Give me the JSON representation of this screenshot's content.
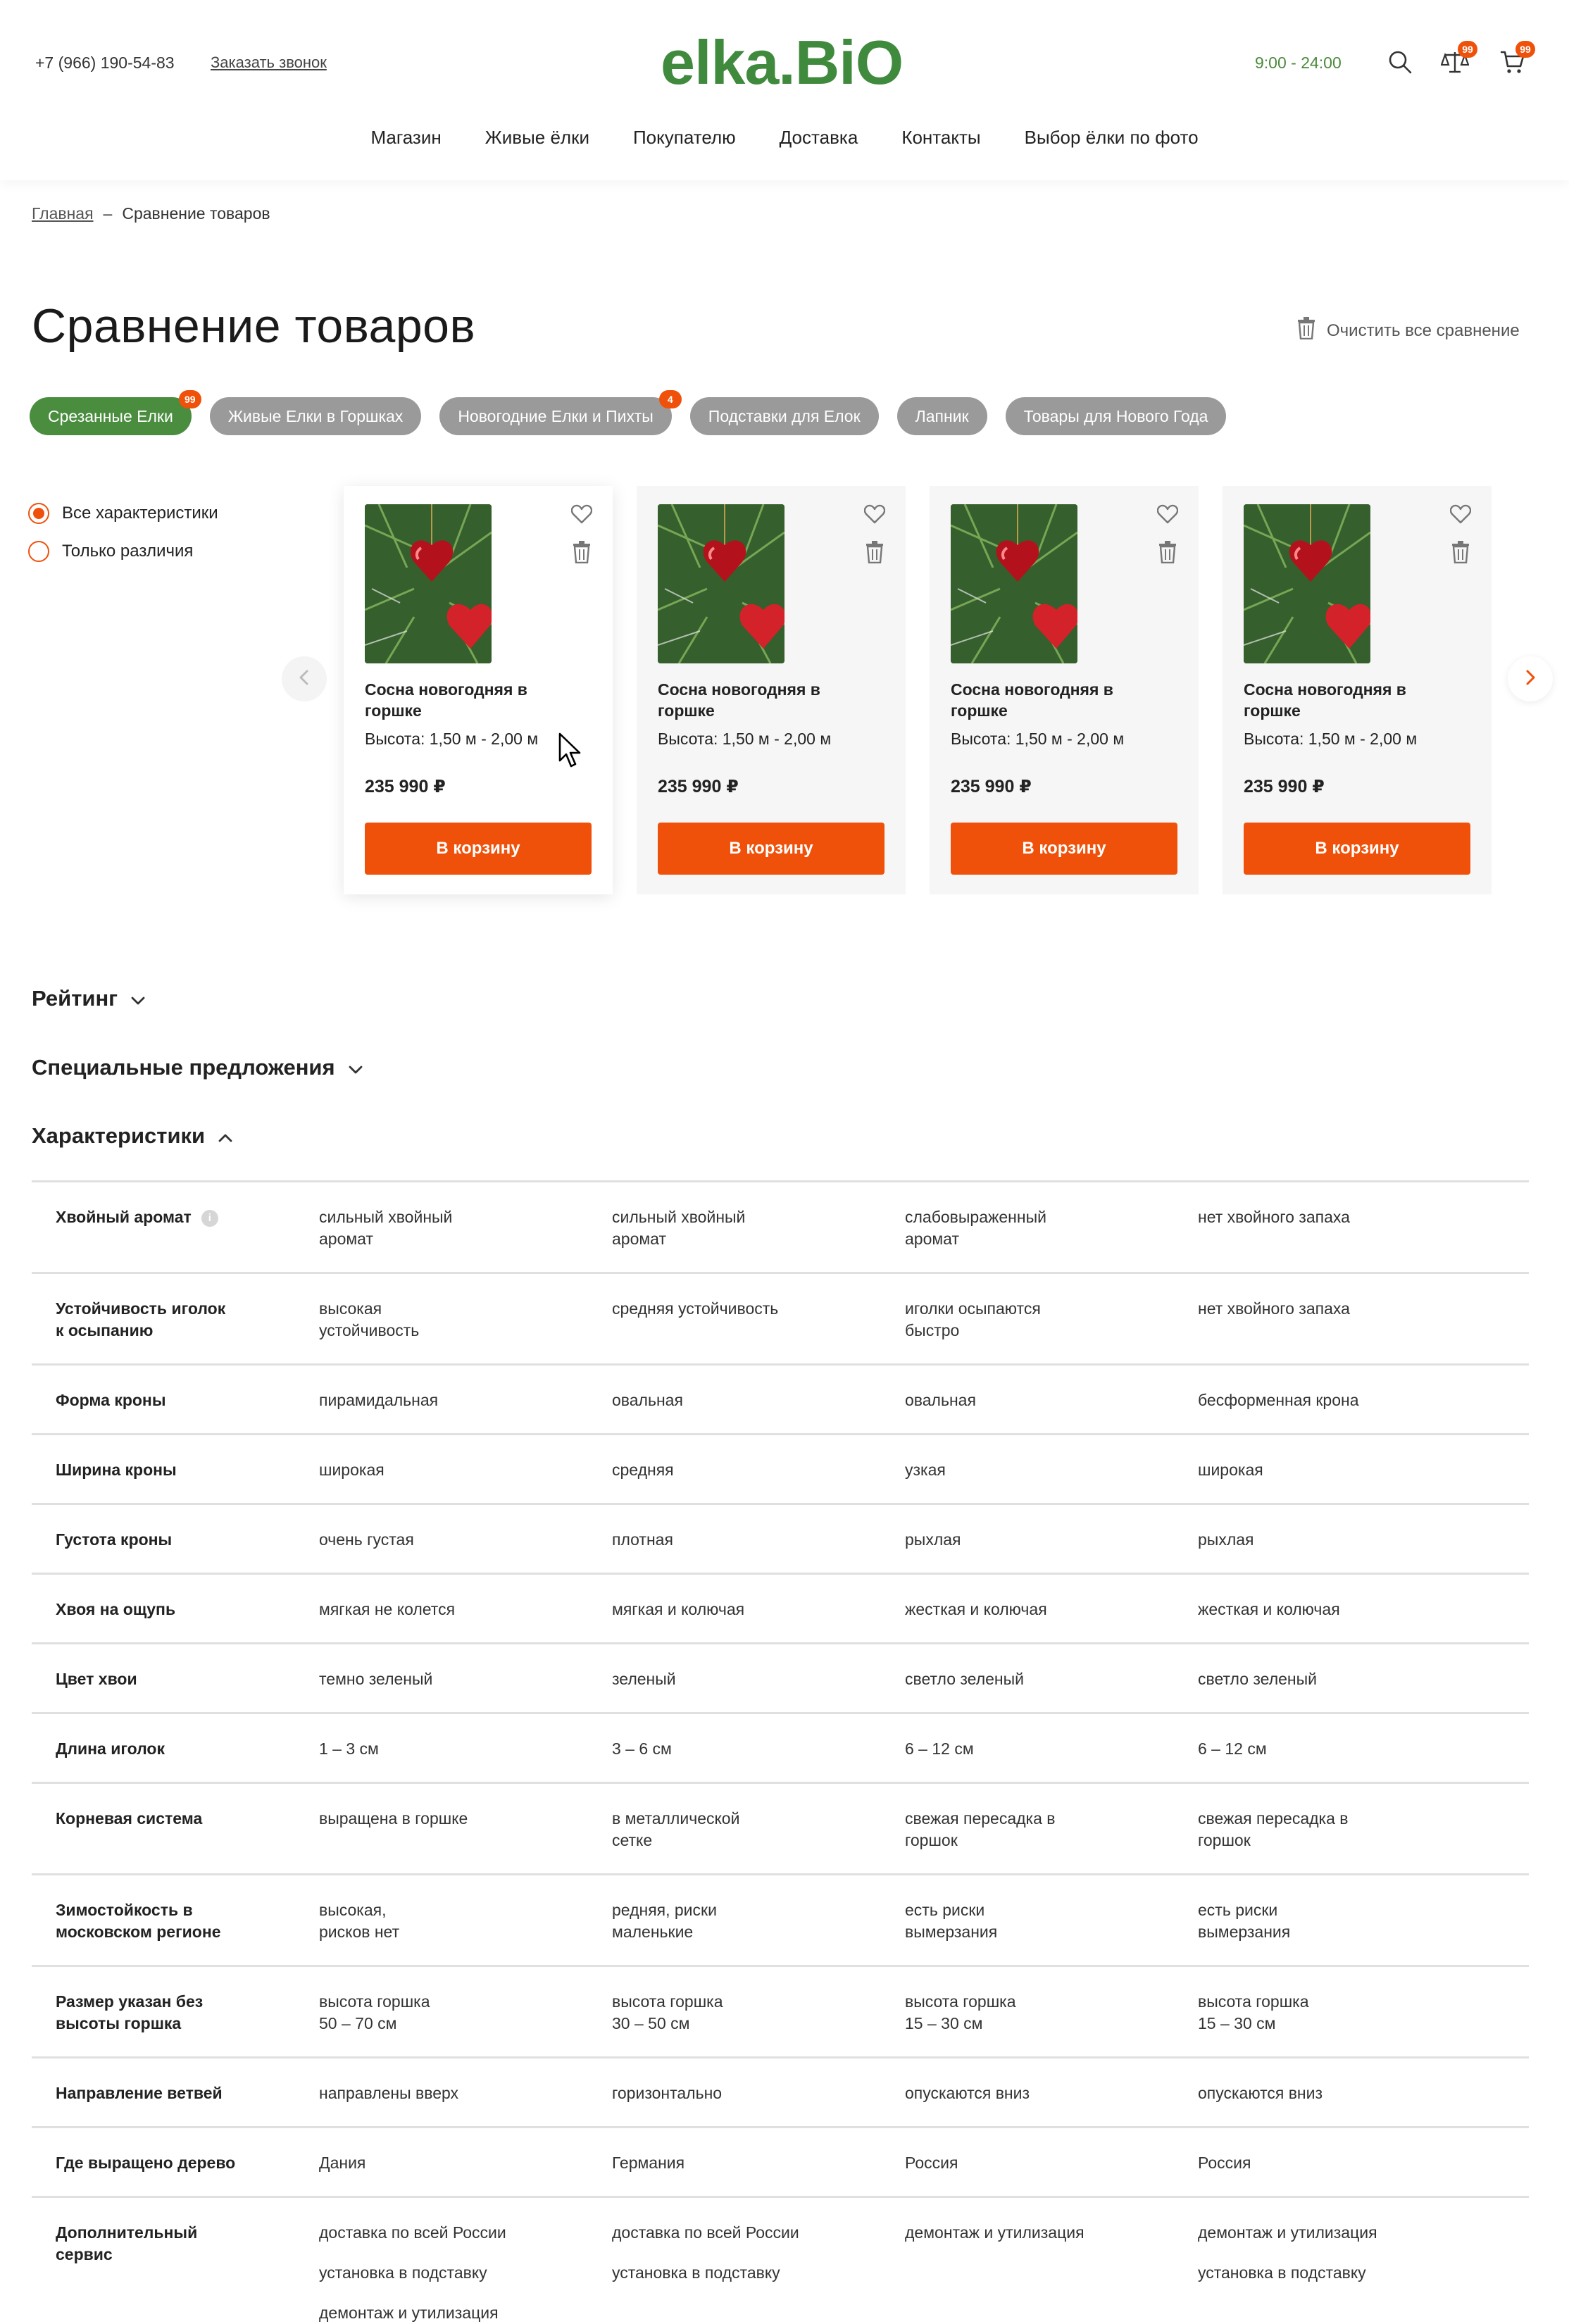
{
  "header": {
    "phone": "+7 (966) 190-54-83",
    "callback": "Заказать звонок",
    "logo": "elka.BiO",
    "hours": "9:00 - 24:00",
    "compare_count": "99",
    "cart_count": "99",
    "nav": [
      "Магазин",
      "Живые ёлки",
      "Покупателю",
      "Доставка",
      "Контакты",
      "Выбор ёлки по фото"
    ]
  },
  "breadcrumb": {
    "home": "Главная",
    "sep": "–",
    "current": "Сравнение товаров"
  },
  "page": {
    "title": "Сравнение товаров",
    "clear_all": "Очистить все сравнение"
  },
  "categories": [
    {
      "label": "Срезанные Елки",
      "badge": "99",
      "active": true
    },
    {
      "label": "Живые Елки в Горшках",
      "badge": "",
      "active": false
    },
    {
      "label": "Новогодние Елки и Пихты",
      "badge": "4",
      "active": false
    },
    {
      "label": "Подставки для Елок",
      "badge": "",
      "active": false
    },
    {
      "label": "Лапник",
      "badge": "",
      "active": false
    },
    {
      "label": "Товары для Нового Года",
      "badge": "",
      "active": false
    }
  ],
  "filters": {
    "all": "Все характеристики",
    "diff": "Только различия"
  },
  "products": [
    {
      "name": "Сосна новогодняя в горшке",
      "height_label": "Высота:",
      "height": "1,50 м - 2,00 м",
      "price": "235 990 ₽",
      "button": "В корзину"
    },
    {
      "name": "Сосна новогодняя в горшке",
      "height_label": "Высота:",
      "height": "1,50 м - 2,00 м",
      "price": "235 990 ₽",
      "button": "В корзину"
    },
    {
      "name": "Сосна новогодняя в горшке",
      "height_label": "Высота:",
      "height": "1,50 м - 2,00 м",
      "price": "235 990 ₽",
      "button": "В корзину"
    },
    {
      "name": "Сосна новогодняя в горшке",
      "height_label": "Высота:",
      "height": "1,50 м - 2,00 м",
      "price": "235 990 ₽",
      "button": "В корзину"
    }
  ],
  "sections": {
    "rating": "Рейтинг",
    "offers": "Специальные предложения",
    "specs": "Характеристики"
  },
  "specs": [
    {
      "name": "Хвойный аромат",
      "info": true,
      "values": [
        [
          "сильный хвойный\nаромат"
        ],
        [
          "сильный хвойный\nаромат"
        ],
        [
          "слабовыраженный\nаромат"
        ],
        [
          "нет хвойного запаха"
        ]
      ]
    },
    {
      "name": "Устойчивость иголок\nк осыпанию",
      "values": [
        [
          "высокая\nустойчивость"
        ],
        [
          "средняя устойчивость"
        ],
        [
          "иголки осыпаются\nбыстро"
        ],
        [
          "нет хвойного запаха"
        ]
      ]
    },
    {
      "name": "Форма кроны",
      "values": [
        [
          "пирамидальная"
        ],
        [
          "овальная"
        ],
        [
          "овальная"
        ],
        [
          "бесформенная крона"
        ]
      ]
    },
    {
      "name": "Ширина кроны",
      "values": [
        [
          "широкая"
        ],
        [
          "средняя"
        ],
        [
          "узкая"
        ],
        [
          "широкая"
        ]
      ]
    },
    {
      "name": "Густота кроны",
      "values": [
        [
          "очень густая"
        ],
        [
          "плотная"
        ],
        [
          "рыхлая"
        ],
        [
          "рыхлая"
        ]
      ]
    },
    {
      "name": "Хвоя на ощупь",
      "values": [
        [
          "мягкая не колется"
        ],
        [
          "мягкая и колючая"
        ],
        [
          "жесткая и колючая"
        ],
        [
          "жесткая и колючая"
        ]
      ]
    },
    {
      "name": "Цвет хвои",
      "values": [
        [
          "темно зеленый"
        ],
        [
          "зеленый"
        ],
        [
          "светло зеленый"
        ],
        [
          "светло зеленый"
        ]
      ]
    },
    {
      "name": "Длина иголок",
      "values": [
        [
          "1 – 3 см"
        ],
        [
          "3 – 6 см"
        ],
        [
          "6 – 12 см"
        ],
        [
          "6 – 12 см"
        ]
      ]
    },
    {
      "name": "Корневая система",
      "values": [
        [
          "выращена в горшке"
        ],
        [
          "в металлической\nсетке"
        ],
        [
          "свежая пересадка в\nгоршок"
        ],
        [
          "свежая пересадка в\nгоршок"
        ]
      ]
    },
    {
      "name": "Зимостойкость в\nмосковском регионе",
      "values": [
        [
          "высокая,\nрисков нет"
        ],
        [
          "редняя, риски\nмаленькие"
        ],
        [
          "есть риски\nвымерзания"
        ],
        [
          "есть риски\nвымерзания"
        ]
      ]
    },
    {
      "name": "Размер указан без\nвысоты горшка",
      "values": [
        [
          "высота горшка\n50 – 70 см"
        ],
        [
          "высота горшка\n30 – 50 см"
        ],
        [
          "высота горшка\n15 – 30 см"
        ],
        [
          "высота горшка\n15 – 30 см"
        ]
      ]
    },
    {
      "name": "Направление ветвей",
      "values": [
        [
          "направлены вверх"
        ],
        [
          "горизонтально"
        ],
        [
          "опускаются вниз"
        ],
        [
          "опускаются вниз"
        ]
      ]
    },
    {
      "name": "Где выращено дерево",
      "values": [
        [
          "Дания"
        ],
        [
          "Германия"
        ],
        [
          "Россия"
        ],
        [
          "Россия"
        ]
      ]
    },
    {
      "name": "Дополнительный\nсервис",
      "values": [
        [
          "доставка по всей России",
          "установка в подставку",
          "демонтаж и утилизация"
        ],
        [
          "доставка по всей России",
          "установка в подставку"
        ],
        [
          "демонтаж и утилизация"
        ],
        [
          "демонтаж и утилизация",
          "установка в подставку"
        ]
      ]
    }
  ],
  "colors": {
    "accent": "#f0510a",
    "brand": "#4a8d3f",
    "pill_gray": "#9a9a9a"
  }
}
